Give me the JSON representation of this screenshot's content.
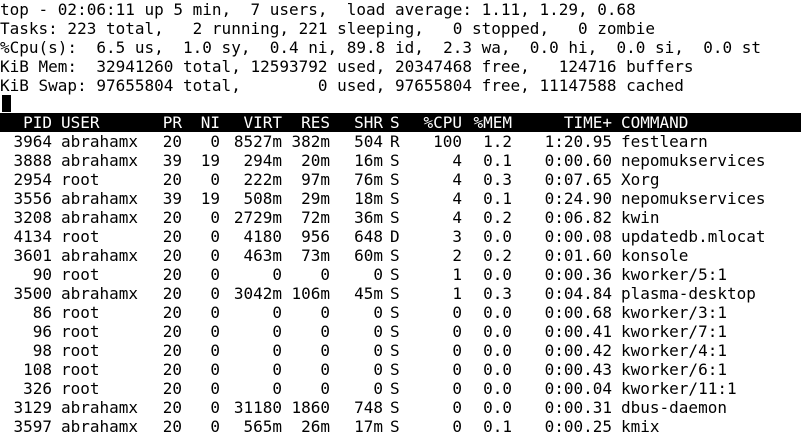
{
  "summary": {
    "line1": "top - 02:06:11 up 5 min,  7 users,  load average: 1.11, 1.29, 0.68",
    "line2": "Tasks: 223 total,   2 running, 221 sleeping,   0 stopped,   0 zombie",
    "line3": "%Cpu(s):  6.5 us,  1.0 sy,  0.4 ni, 89.8 id,  2.3 wa,  0.0 hi,  0.0 si,  0.0 st",
    "line4": "KiB Mem:  32941260 total, 12593792 used, 20347468 free,   124716 buffers",
    "line5": "KiB Swap: 97655804 total,        0 used, 97655804 free, 11147588 cached"
  },
  "columns": {
    "pid": "PID",
    "user": "USER",
    "pr": "PR",
    "ni": "NI",
    "virt": "VIRT",
    "res": "RES",
    "shr": "SHR",
    "s": "S",
    "cpu": "%CPU",
    "mem": "%MEM",
    "time": "TIME+",
    "command": "COMMAND"
  },
  "processes": [
    {
      "pid": "3964",
      "user": "abrahamx",
      "pr": "20",
      "ni": "0",
      "virt": "8527m",
      "res": "382m",
      "shr": "504",
      "s": "R",
      "cpu": "100",
      "mem": "1.2",
      "time": "1:20.95",
      "command": "festlearn"
    },
    {
      "pid": "3888",
      "user": "abrahamx",
      "pr": "39",
      "ni": "19",
      "virt": "294m",
      "res": "20m",
      "shr": "16m",
      "s": "S",
      "cpu": "4",
      "mem": "0.1",
      "time": "0:00.60",
      "command": "nepomukservices"
    },
    {
      "pid": "2954",
      "user": "root",
      "pr": "20",
      "ni": "0",
      "virt": "222m",
      "res": "97m",
      "shr": "76m",
      "s": "S",
      "cpu": "4",
      "mem": "0.3",
      "time": "0:07.65",
      "command": "Xorg"
    },
    {
      "pid": "3556",
      "user": "abrahamx",
      "pr": "39",
      "ni": "19",
      "virt": "508m",
      "res": "29m",
      "shr": "18m",
      "s": "S",
      "cpu": "4",
      "mem": "0.1",
      "time": "0:24.90",
      "command": "nepomukservices"
    },
    {
      "pid": "3208",
      "user": "abrahamx",
      "pr": "20",
      "ni": "0",
      "virt": "2729m",
      "res": "72m",
      "shr": "36m",
      "s": "S",
      "cpu": "4",
      "mem": "0.2",
      "time": "0:06.82",
      "command": "kwin"
    },
    {
      "pid": "4134",
      "user": "root",
      "pr": "20",
      "ni": "0",
      "virt": "4180",
      "res": "956",
      "shr": "648",
      "s": "D",
      "cpu": "3",
      "mem": "0.0",
      "time": "0:00.08",
      "command": "updatedb.mlocat"
    },
    {
      "pid": "3601",
      "user": "abrahamx",
      "pr": "20",
      "ni": "0",
      "virt": "463m",
      "res": "73m",
      "shr": "60m",
      "s": "S",
      "cpu": "2",
      "mem": "0.2",
      "time": "0:01.60",
      "command": "konsole"
    },
    {
      "pid": "90",
      "user": "root",
      "pr": "20",
      "ni": "0",
      "virt": "0",
      "res": "0",
      "shr": "0",
      "s": "S",
      "cpu": "1",
      "mem": "0.0",
      "time": "0:00.36",
      "command": "kworker/5:1"
    },
    {
      "pid": "3500",
      "user": "abrahamx",
      "pr": "20",
      "ni": "0",
      "virt": "3042m",
      "res": "106m",
      "shr": "45m",
      "s": "S",
      "cpu": "1",
      "mem": "0.3",
      "time": "0:04.84",
      "command": "plasma-desktop"
    },
    {
      "pid": "86",
      "user": "root",
      "pr": "20",
      "ni": "0",
      "virt": "0",
      "res": "0",
      "shr": "0",
      "s": "S",
      "cpu": "0",
      "mem": "0.0",
      "time": "0:00.68",
      "command": "kworker/3:1"
    },
    {
      "pid": "96",
      "user": "root",
      "pr": "20",
      "ni": "0",
      "virt": "0",
      "res": "0",
      "shr": "0",
      "s": "S",
      "cpu": "0",
      "mem": "0.0",
      "time": "0:00.41",
      "command": "kworker/7:1"
    },
    {
      "pid": "98",
      "user": "root",
      "pr": "20",
      "ni": "0",
      "virt": "0",
      "res": "0",
      "shr": "0",
      "s": "S",
      "cpu": "0",
      "mem": "0.0",
      "time": "0:00.42",
      "command": "kworker/4:1"
    },
    {
      "pid": "108",
      "user": "root",
      "pr": "20",
      "ni": "0",
      "virt": "0",
      "res": "0",
      "shr": "0",
      "s": "S",
      "cpu": "0",
      "mem": "0.0",
      "time": "0:00.43",
      "command": "kworker/6:1"
    },
    {
      "pid": "326",
      "user": "root",
      "pr": "20",
      "ni": "0",
      "virt": "0",
      "res": "0",
      "shr": "0",
      "s": "S",
      "cpu": "0",
      "mem": "0.0",
      "time": "0:00.04",
      "command": "kworker/11:1"
    },
    {
      "pid": "3129",
      "user": "abrahamx",
      "pr": "20",
      "ni": "0",
      "virt": "31180",
      "res": "1860",
      "shr": "748",
      "s": "S",
      "cpu": "0",
      "mem": "0.0",
      "time": "0:00.31",
      "command": "dbus-daemon"
    },
    {
      "pid": "3597",
      "user": "abrahamx",
      "pr": "20",
      "ni": "0",
      "virt": "565m",
      "res": "26m",
      "shr": "17m",
      "s": "S",
      "cpu": "0",
      "mem": "0.1",
      "time": "0:00.25",
      "command": "kmix"
    }
  ]
}
